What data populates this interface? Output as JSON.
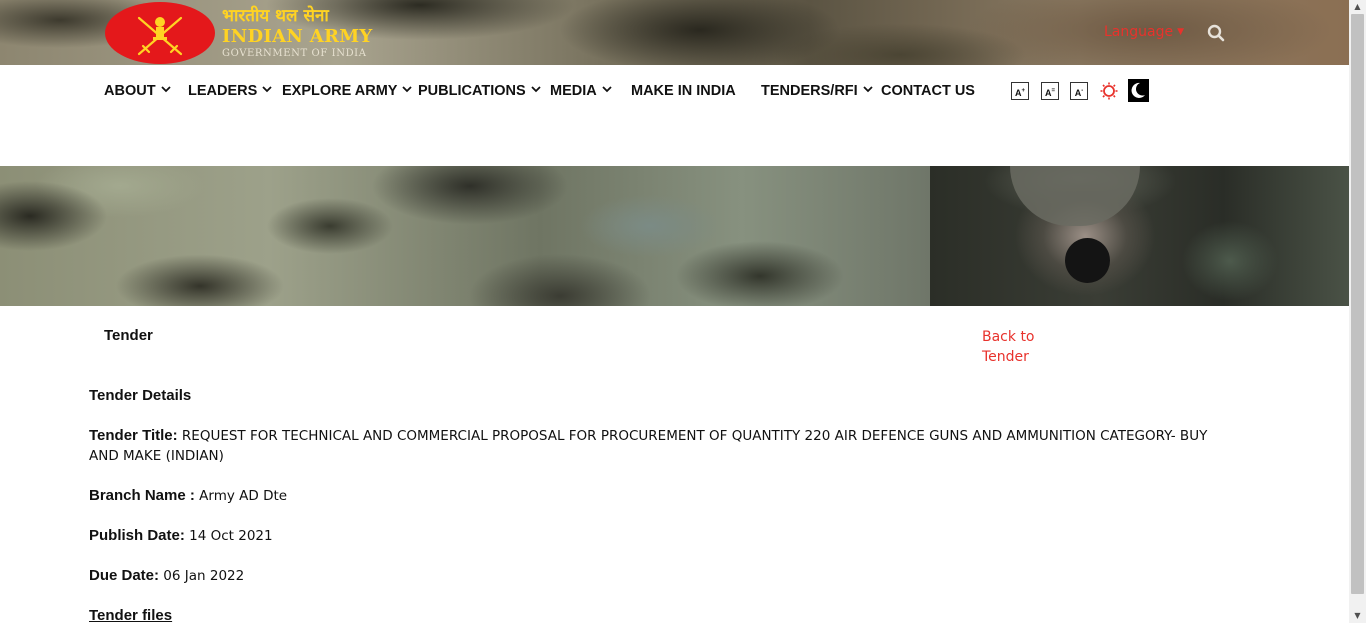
{
  "header": {
    "logo_hindi": "भारतीय थल सेना",
    "logo_english": "INDIAN ARMY",
    "logo_govt": "GOVERNMENT OF INDIA",
    "language_label": "Language",
    "accent_color": "#e8322c",
    "logo_color": "#e4181b"
  },
  "nav": {
    "items": [
      {
        "label": "ABOUT",
        "has_dropdown": true
      },
      {
        "label": "LEADERS",
        "has_dropdown": true
      },
      {
        "label": "EXPLORE ARMY",
        "has_dropdown": true
      },
      {
        "label": "PUBLICATIONS",
        "has_dropdown": true
      },
      {
        "label": "MEDIA",
        "has_dropdown": true
      },
      {
        "label": "MAKE IN INDIA",
        "has_dropdown": false
      },
      {
        "label": "TENDERS/RFI",
        "has_dropdown": true
      },
      {
        "label": "CONTACT US",
        "has_dropdown": false
      }
    ],
    "tools": {
      "font_increase": "A",
      "font_reset": "A",
      "font_decrease": "A",
      "increase_sup": "+",
      "reset_sup": "=",
      "decrease_sup": "-"
    }
  },
  "page": {
    "heading": "Tender",
    "back_link": "Back to Tender",
    "details_title": "Tender Details",
    "fields": [
      {
        "label": "Tender Title:",
        "value": " REQUEST FOR TECHNICAL AND COMMERCIAL PROPOSAL FOR PROCUREMENT OF QUANTITY 220 AIR DEFENCE GUNS AND AMMUNITION CATEGORY- BUY AND MAKE (INDIAN)"
      },
      {
        "label": "Branch Name :",
        "value": " Army AD Dte"
      },
      {
        "label": "Publish Date:",
        "value": " 14 Oct 2021"
      },
      {
        "label": "Due Date:",
        "value": " 06 Jan 2022"
      }
    ],
    "files_label": "Tender files"
  }
}
